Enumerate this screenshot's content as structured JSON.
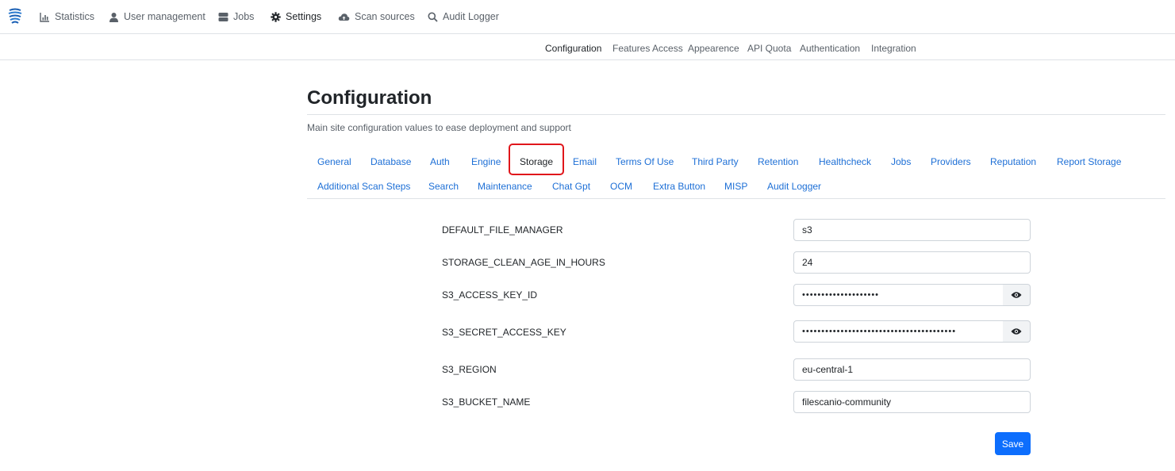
{
  "topnav": {
    "items": [
      {
        "label": "Statistics",
        "icon": "chart-icon"
      },
      {
        "label": "User management",
        "icon": "user-icon"
      },
      {
        "label": "Jobs",
        "icon": "server-icon"
      },
      {
        "label": "Settings",
        "icon": "gear-icon",
        "active": true
      },
      {
        "label": "Scan sources",
        "icon": "cloud-upload-icon"
      },
      {
        "label": "Audit Logger",
        "icon": "search-icon"
      }
    ]
  },
  "subnav": {
    "items": [
      "Configuration",
      "Features Access",
      "Appearence",
      "API Quota",
      "Authentication",
      "Integration"
    ],
    "active": "Configuration"
  },
  "page": {
    "title": "Configuration",
    "subtitle": "Main site configuration values to ease deployment and support"
  },
  "tabs": {
    "row1": [
      "General",
      "Database",
      "Auth",
      "Engine",
      "Storage",
      "Email",
      "Terms Of Use",
      "Third Party",
      "Retention",
      "Healthcheck",
      "Jobs",
      "Providers",
      "Reputation",
      "Report Storage"
    ],
    "row2": [
      "Additional Scan Steps",
      "Search",
      "Maintenance",
      "Chat Gpt",
      "OCM",
      "Extra Button",
      "MISP",
      "Audit Logger"
    ],
    "active": "Storage"
  },
  "form": {
    "fields": [
      {
        "label": "DEFAULT_FILE_MANAGER",
        "value": "s3"
      },
      {
        "label": "STORAGE_CLEAN_AGE_IN_HOURS",
        "value": "24"
      },
      {
        "label": "S3_ACCESS_KEY_ID",
        "value": "••••••••••••••••••••"
      },
      {
        "label": "S3_SECRET_ACCESS_KEY",
        "value": "••••••••••••••••••••••••••••••••••••••••"
      },
      {
        "label": "S3_REGION",
        "value": "eu-central-1"
      },
      {
        "label": "S3_BUCKET_NAME",
        "value": "filescanio-community"
      }
    ],
    "save_label": "Save"
  },
  "colors": {
    "link": "#1d6fd6",
    "primary": "#0d6efd",
    "highlight": "#e0161b"
  }
}
